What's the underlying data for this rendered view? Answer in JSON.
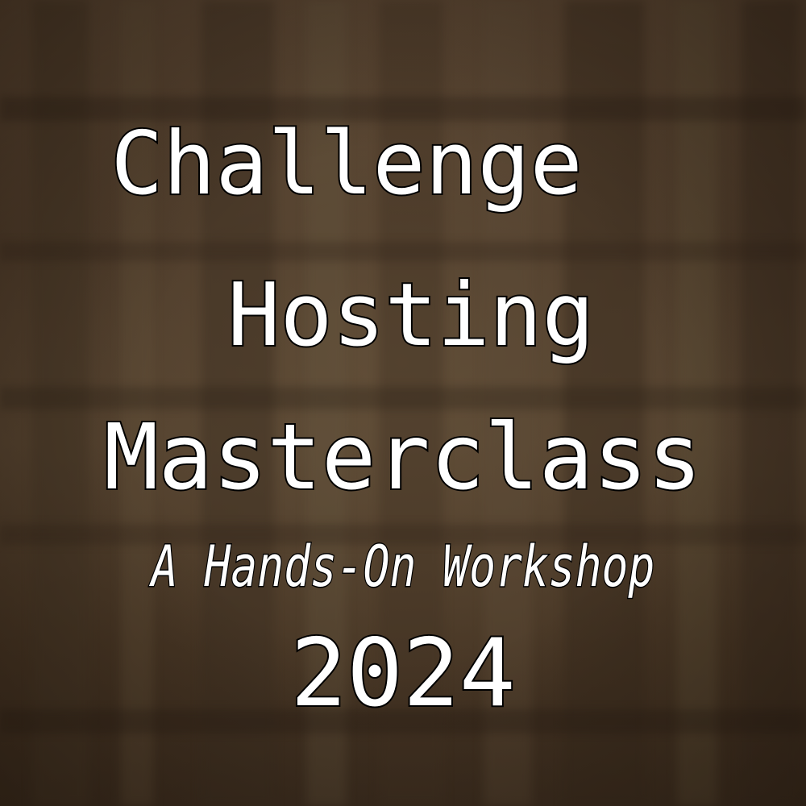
{
  "poster": {
    "title_line1": "Challenge",
    "title_line2": "Hosting",
    "title_line3": "Masterclass",
    "subtitle": "A Hands-On Workshop",
    "year": "2024"
  },
  "colors": {
    "text_fill": "#ffffff",
    "text_outline": "#000000",
    "background_base": "#4d3b2a"
  }
}
